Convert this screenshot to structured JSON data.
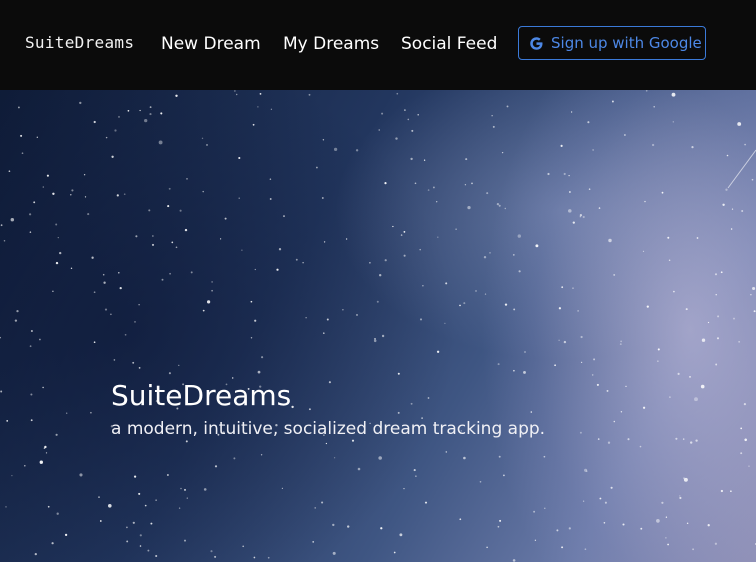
{
  "navbar": {
    "brand": "SuiteDreams",
    "links": [
      {
        "label": "New Dream"
      },
      {
        "label": "My Dreams"
      },
      {
        "label": "Social Feed"
      }
    ],
    "signup": {
      "label": "Sign up with Google",
      "icon": "google-icon",
      "color": "#3b7ad9"
    }
  },
  "hero": {
    "title": "SuiteDreams",
    "subtitle": "a modern, intuitive, socialized dream tracking app."
  }
}
